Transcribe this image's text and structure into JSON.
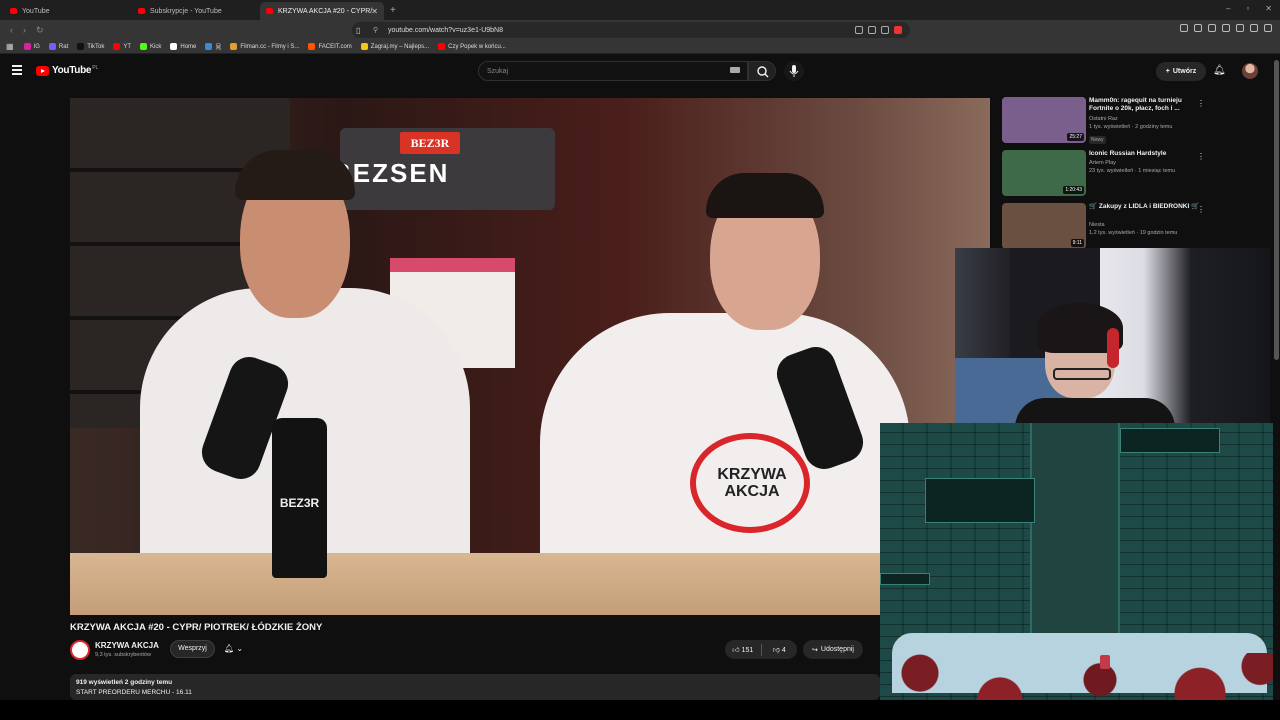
{
  "browser": {
    "tabs": [
      {
        "label": "YouTube",
        "active": false
      },
      {
        "label": "Subskrypcje - YouTube",
        "active": false
      },
      {
        "label": "KRZYWA AKCJA #20 - CYPR/",
        "active": true
      }
    ],
    "new_tab_icon": "plus-icon",
    "url": "youtube.com/watch?v=uz3e1-U9bN8",
    "bookmarks": [
      {
        "label": "IG",
        "color": "#d6249f"
      },
      {
        "label": "Rat",
        "color": "#7b5cff"
      },
      {
        "label": "TikTok",
        "color": "#111111"
      },
      {
        "label": "YT",
        "color": "#ff0000"
      },
      {
        "label": "Kick",
        "color": "#53fc18"
      },
      {
        "label": "Home",
        "color": "#ffffff"
      },
      {
        "label": "見",
        "color": "#3a8ad6"
      },
      {
        "label": "Filman.cc - Filmy i S...",
        "color": "#e0a030"
      },
      {
        "label": "FACEIT.com",
        "color": "#ff5500"
      },
      {
        "label": "Zagraj.my – Najleps...",
        "color": "#f5c518"
      },
      {
        "label": "Czy Popek w końcu...",
        "color": "#ff0000"
      }
    ]
  },
  "youtube": {
    "logo_text": "YouTube",
    "country": "PL",
    "search_placeholder": "Szukaj",
    "create_label": "Utwórz",
    "brand_color": "#ff0000"
  },
  "video": {
    "title": "KRZYWA AKCJA #20 - CYPR/ PIOTREK/ ŁÓDZKIE ŻONY",
    "channel": "KRZYWA AKCJA",
    "subscribers": "9,3 tys. subskrybentów",
    "support_label": "Wesprzyj",
    "likes": "151",
    "dislikes": "4",
    "share_label": "Udostępnij",
    "views": "919 wyświetleń",
    "posted": "2 godziny temu",
    "description_line": "START PREORDERU MERCHU - 16.11",
    "scene_text": {
      "sign_top": "BEZ3R",
      "sign_main": "BEZSEN",
      "bottle": "BEZ3R",
      "shirt_1": "KRZYWA",
      "shirt_2": "AKCJA"
    }
  },
  "recommendations": [
    {
      "title": "Mamm0n: ragequit na turnieju Fortnite o 20k, płacz, foch i ...",
      "channel": "Ostatni Raz",
      "meta": "1 tys. wyświetleń · 2 godziny temu",
      "badge": "Nowy",
      "duration": "25:27",
      "thumb_color": "#7a5f8c"
    },
    {
      "title": "Iconic Russian Hardstyle",
      "channel": "Artem Play",
      "meta": "23 tys. wyświetleń · 1 miesiąc temu",
      "badge": "",
      "duration": "1:20:43",
      "thumb_color": "#3f6a4a"
    },
    {
      "title": "🛒 Zakupy z LIDLA i BIEDRONKI 🛒",
      "channel": "Niesta",
      "meta": "1,2 tys. wyświetleń · 19 godzin temu",
      "badge": "",
      "duration": "9:11",
      "thumb_color": "#6a5040"
    }
  ]
}
